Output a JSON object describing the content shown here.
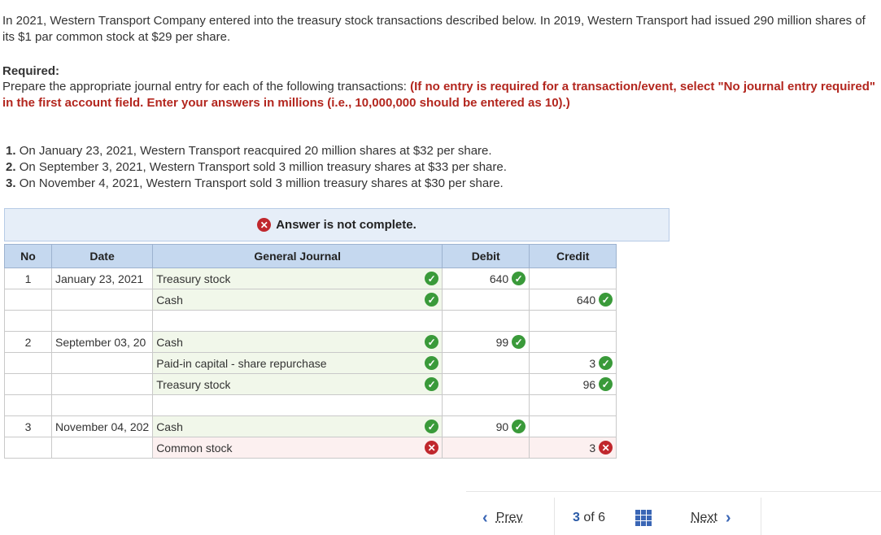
{
  "intro": "In 2021, Western Transport Company entered into the treasury stock transactions described below. In 2019, Western Transport had issued 290 million shares of its $1 par common stock at $29 per share.",
  "required": {
    "heading": "Required:",
    "text": "Prepare the appropriate journal entry for each of the following transactions: ",
    "instruction": "(If no entry is required for a transaction/event, select \"No journal entry required\" in the first account field. Enter your answers in millions (i.e., 10,000,000 should be entered as 10).)"
  },
  "transactions": [
    {
      "num": "1.",
      "text": "On January 23, 2021, Western Transport reacquired 20 million shares at $32 per share."
    },
    {
      "num": "2.",
      "text": "On September 3, 2021, Western Transport sold 3 million treasury shares at $33 per share."
    },
    {
      "num": "3.",
      "text": "On November 4, 2021, Western Transport sold 3 million treasury shares at $30 per share."
    }
  ],
  "banner": {
    "text": "Answer is not complete.",
    "icon": "x-circle-icon",
    "color": "#c0272d"
  },
  "table": {
    "headers": {
      "no": "No",
      "date": "Date",
      "journal": "General Journal",
      "debit": "Debit",
      "credit": "Credit"
    },
    "rows": [
      {
        "no": "1",
        "date": "January 23, 2021",
        "account": "Treasury stock",
        "indent": false,
        "acct_status": "ok",
        "debit": "640",
        "debit_status": "ok",
        "credit": "",
        "credit_status": ""
      },
      {
        "no": "",
        "date": "",
        "account": "Cash",
        "indent": true,
        "acct_status": "ok",
        "debit": "",
        "debit_status": "",
        "credit": "640",
        "credit_status": "ok"
      },
      {
        "gap": true
      },
      {
        "no": "2",
        "date": "September 03, 20",
        "account": "Cash",
        "indent": false,
        "acct_status": "ok",
        "debit": "99",
        "debit_status": "ok",
        "credit": "",
        "credit_status": ""
      },
      {
        "no": "",
        "date": "",
        "account": "Paid-in capital - share repurchase",
        "indent": true,
        "acct_status": "ok",
        "debit": "",
        "debit_status": "",
        "credit": "3",
        "credit_status": "ok"
      },
      {
        "no": "",
        "date": "",
        "account": "Treasury stock",
        "indent": true,
        "acct_status": "ok",
        "debit": "",
        "debit_status": "",
        "credit": "96",
        "credit_status": "ok"
      },
      {
        "gap": true
      },
      {
        "no": "3",
        "date": "November 04, 202",
        "account": "Cash",
        "indent": false,
        "acct_status": "ok",
        "debit": "90",
        "debit_status": "ok",
        "credit": "",
        "credit_status": ""
      },
      {
        "no": "",
        "date": "",
        "account": "Common stock",
        "indent": true,
        "acct_status": "bad",
        "debit": "",
        "debit_status": "",
        "credit": "3",
        "credit_status": "bad"
      }
    ]
  },
  "pager": {
    "prev": "Prev",
    "current": "3",
    "of": "of",
    "total": "6",
    "next": "Next"
  },
  "colors": {
    "ok": "#3a9a3a",
    "bad": "#c0272d",
    "header_bg": "#c5d8ef",
    "link": "#3a66b5"
  }
}
